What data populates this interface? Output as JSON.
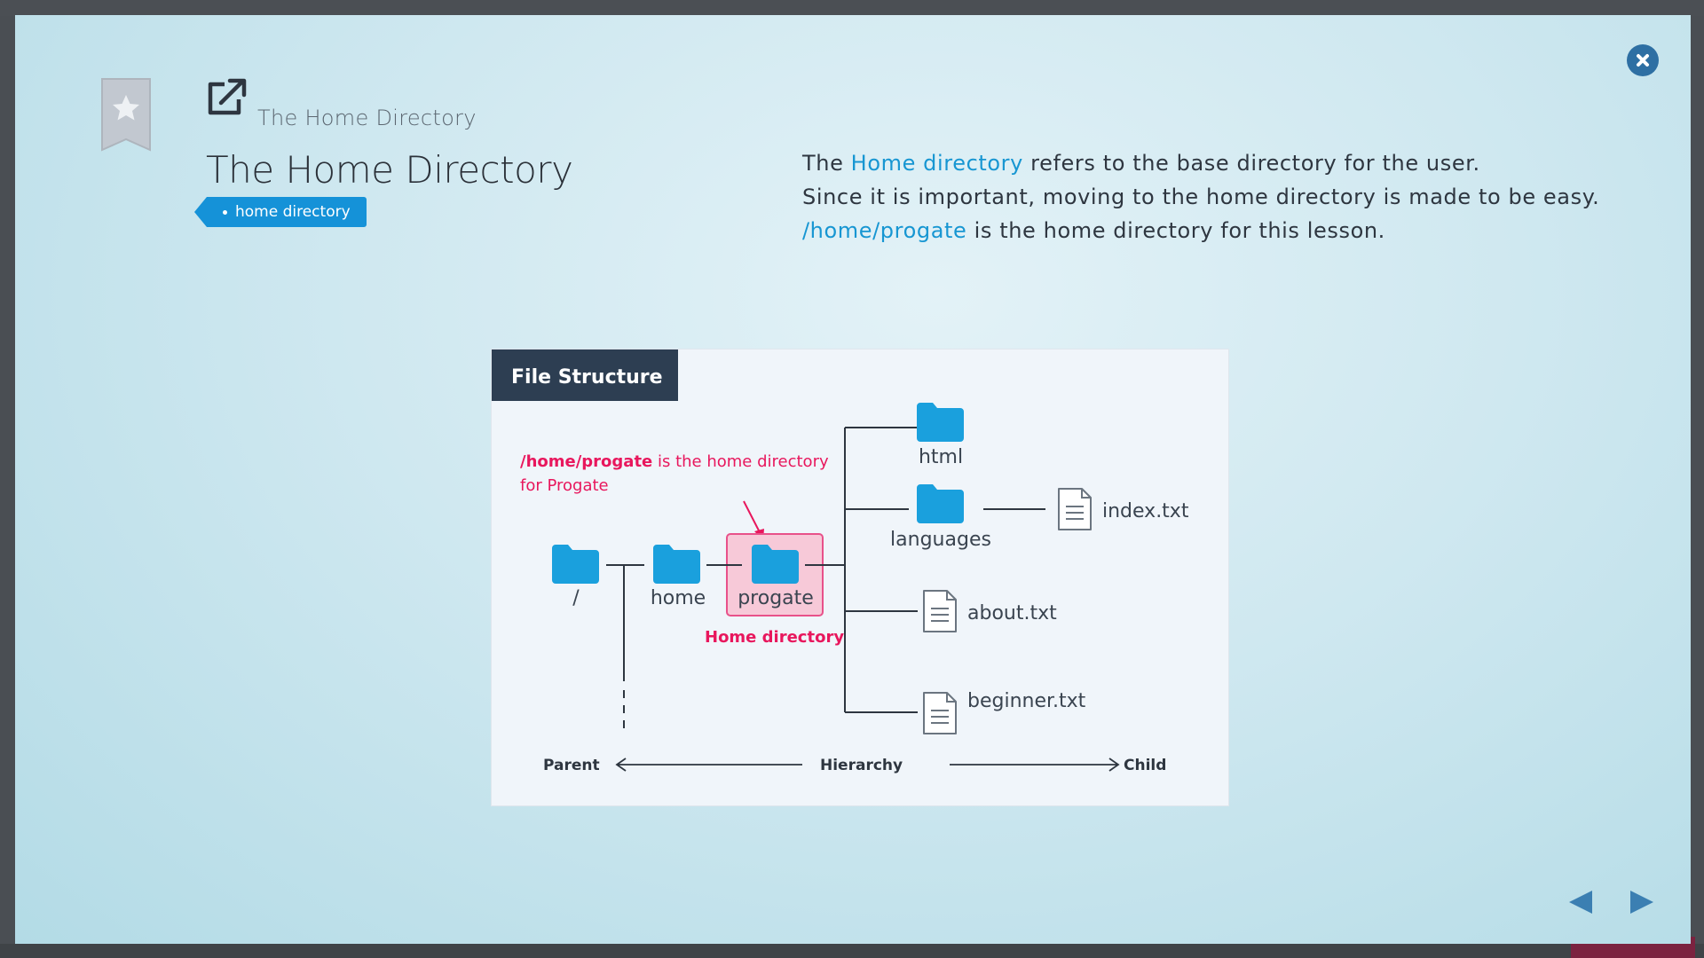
{
  "lesson": {
    "breadcrumb": "The Home Directory",
    "title": "The Home Directory",
    "tag": "home directory"
  },
  "description": {
    "line1_pre": "The ",
    "line1_link": "Home directory",
    "line1_post": " refers to the base directory for the user.",
    "line2": "Since it is important, moving to the home directory is made to be easy.",
    "line3_link": "/home/progate",
    "line3_post": " is the home directory for this lesson."
  },
  "figure": {
    "header": "File Structure",
    "annotation_bold": "/home/progate",
    "annotation_rest": " is the home directory",
    "annotation_line2": "for Progate",
    "folders": {
      "root": "/",
      "home": "home",
      "progate": "progate",
      "html": "html",
      "languages": "languages"
    },
    "files": {
      "index": "index.txt",
      "about": "about.txt",
      "beginner": "beginner.txt"
    },
    "home_dir_label": "Home directory",
    "hierarchy": {
      "parent": "Parent",
      "center": "Hierarchy",
      "child": "Child"
    }
  },
  "colors": {
    "accent": "#1796d2",
    "folder": "#1aa0dd",
    "highlight": "#e8175d",
    "header_bg": "#2d3e52",
    "close": "#2e6fa3"
  },
  "icons": {
    "close": "close-icon",
    "bookmark": "bookmark-star-icon",
    "external": "external-link-icon",
    "prev": "prev-arrow-icon",
    "next": "next-arrow-icon"
  }
}
